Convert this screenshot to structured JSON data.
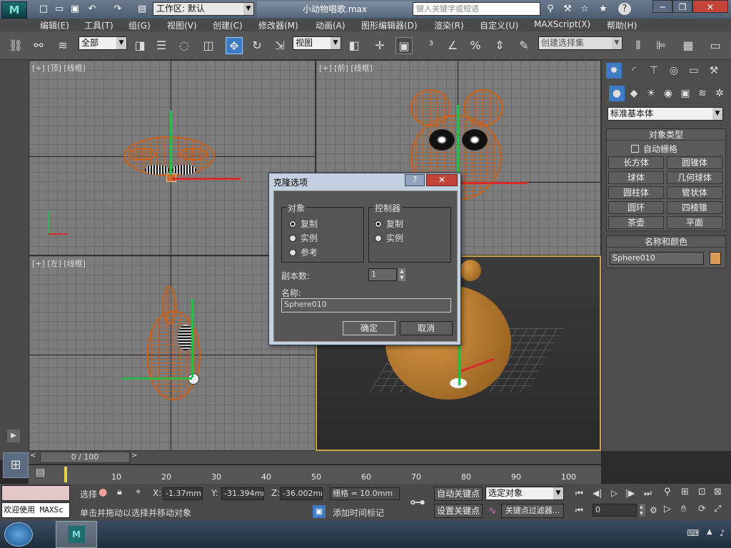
{
  "titlebar": {
    "workspace_label": "工作区: 默认",
    "doc_title": "小动物唱歌.max",
    "search_placeholder": "键入关键字或短语"
  },
  "menu": [
    "编辑(E)",
    "工具(T)",
    "组(G)",
    "视图(V)",
    "创建(C)",
    "修改器(M)",
    "动画(A)",
    "图形编辑器(D)",
    "渲染(R)",
    "自定义(U)",
    "MAXScript(X)",
    "帮助(H)"
  ],
  "toolbar": {
    "filter_select": "全部",
    "refcoord_select": "视图",
    "selection_set_placeholder": "创建选择集"
  },
  "viewports": {
    "top": "[+] [顶] [线框]",
    "front": "[+] [前] [线框]",
    "left": "[+] [左] [线框]"
  },
  "command_panel": {
    "category_select": "标准基本体",
    "object_type_header": "对象类型",
    "autogrid_label": "自动栅格",
    "object_buttons": [
      "长方体",
      "圆锥体",
      "球体",
      "几何球体",
      "圆柱体",
      "管状体",
      "圆环",
      "四棱锥",
      "茶壶",
      "平面"
    ],
    "name_color_header": "名称和颜色",
    "object_name": "Sphere010",
    "object_color": "#d99b55"
  },
  "dialog": {
    "title": "克隆选项",
    "object_group": "对象",
    "object_options": [
      "复制",
      "实例",
      "参考"
    ],
    "object_selected": 0,
    "controller_group": "控制器",
    "controller_options": [
      "复制",
      "实例"
    ],
    "controller_selected": 0,
    "copies_label": "副本数:",
    "copies_value": "1",
    "name_label": "名称:",
    "name_value": "Sphere010",
    "ok": "确定",
    "cancel": "取消"
  },
  "timeline": {
    "frame": "0 / 100",
    "ticks": [
      "10",
      "20",
      "30",
      "40",
      "50",
      "60",
      "70",
      "80",
      "90",
      "100"
    ]
  },
  "status": {
    "maxscript_listener": "欢迎使用 MAXSc",
    "sel_label": "选择",
    "x_label": "X:",
    "x_value": "-1.37mm",
    "y_label": "Y:",
    "y_value": "-31.394mm",
    "z_label": "Z:",
    "z_value": "-36.002mm",
    "grid_label": "栅格 = 10.0mm",
    "prompt": "单击并拖动以选择并移动对象",
    "add_time_tag": "添加时间标记",
    "auto_key": "自动关键点",
    "set_key": "设置关键点",
    "key_select": "选定对象",
    "key_filters": "关键点过滤器...",
    "frame_field": "0"
  },
  "colors": {
    "wire_orange": "#c8601c",
    "active_border": "#c8a44a",
    "accent_blue": "#3d7bc4"
  }
}
